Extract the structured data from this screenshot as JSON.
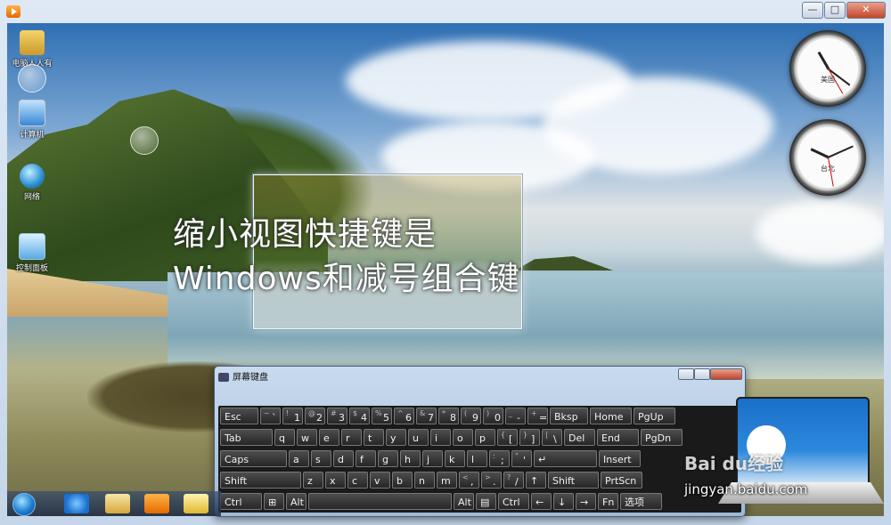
{
  "window": {
    "close_label": "✕",
    "maximize_label": "□",
    "minimize_label": "—"
  },
  "desktop": {
    "icons": [
      {
        "label": "电脑人人有"
      },
      {
        "label": "计算机"
      },
      {
        "label": "网络"
      },
      {
        "label": "控制面板"
      }
    ]
  },
  "clocks": [
    {
      "city": "美国",
      "hour": 10,
      "minute": 51
    },
    {
      "city": "台北",
      "hour": 8,
      "minute": 11
    }
  ],
  "caption": {
    "line1": "缩小视图快捷键是",
    "line2": "Windows和减号组合键"
  },
  "osk": {
    "title": "屏幕键盘",
    "rows": [
      [
        {
          "m": "Esc"
        },
        {
          "s": "~",
          "m": "`"
        },
        {
          "s": "!",
          "m": "1"
        },
        {
          "s": "@",
          "m": "2"
        },
        {
          "s": "#",
          "m": "3"
        },
        {
          "s": "$",
          "m": "4"
        },
        {
          "s": "%",
          "m": "5"
        },
        {
          "s": "^",
          "m": "6"
        },
        {
          "s": "&",
          "m": "7"
        },
        {
          "s": "*",
          "m": "8"
        },
        {
          "s": "(",
          "m": "9"
        },
        {
          "s": ")",
          "m": "0"
        },
        {
          "s": "_",
          "m": "-"
        },
        {
          "s": "+",
          "m": "="
        },
        {
          "m": "Bksp"
        },
        {
          "m": "Home"
        },
        {
          "m": "PgUp"
        }
      ],
      [
        {
          "m": "Tab"
        },
        {
          "m": "q"
        },
        {
          "m": "w"
        },
        {
          "m": "e"
        },
        {
          "m": "r"
        },
        {
          "m": "t"
        },
        {
          "m": "y"
        },
        {
          "m": "u"
        },
        {
          "m": "i"
        },
        {
          "m": "o"
        },
        {
          "m": "p"
        },
        {
          "s": "{",
          "m": "["
        },
        {
          "s": "}",
          "m": "]"
        },
        {
          "s": "|",
          "m": "\\"
        },
        {
          "m": "Del"
        },
        {
          "m": "End"
        },
        {
          "m": "PgDn"
        }
      ],
      [
        {
          "m": "Caps"
        },
        {
          "m": "a"
        },
        {
          "m": "s"
        },
        {
          "m": "d"
        },
        {
          "m": "f"
        },
        {
          "m": "g"
        },
        {
          "m": "h"
        },
        {
          "m": "j"
        },
        {
          "m": "k"
        },
        {
          "m": "l"
        },
        {
          "s": ":",
          "m": ";"
        },
        {
          "s": "\"",
          "m": "'"
        },
        {
          "m": "↵"
        },
        {
          "m": "Insert"
        }
      ],
      [
        {
          "m": "Shift"
        },
        {
          "m": "z"
        },
        {
          "m": "x"
        },
        {
          "m": "c"
        },
        {
          "m": "v"
        },
        {
          "m": "b"
        },
        {
          "m": "n"
        },
        {
          "m": "m"
        },
        {
          "s": "<",
          "m": ","
        },
        {
          "s": ">",
          "m": "."
        },
        {
          "s": "?",
          "m": "/"
        },
        {
          "m": "↑"
        },
        {
          "m": "Shift"
        },
        {
          "m": "PrtScn"
        }
      ],
      [
        {
          "m": "Ctrl"
        },
        {
          "m": "⊞"
        },
        {
          "m": "Alt"
        },
        {
          "m": ""
        },
        {
          "m": "Alt"
        },
        {
          "m": "▤"
        },
        {
          "m": "Ctrl"
        },
        {
          "m": "←"
        },
        {
          "m": "↓"
        },
        {
          "m": "→"
        },
        {
          "m": "Fn"
        },
        {
          "m": "选项"
        }
      ]
    ]
  },
  "watermark": {
    "brand": "Bai du经验",
    "url": "jingyan.baidu.com"
  }
}
